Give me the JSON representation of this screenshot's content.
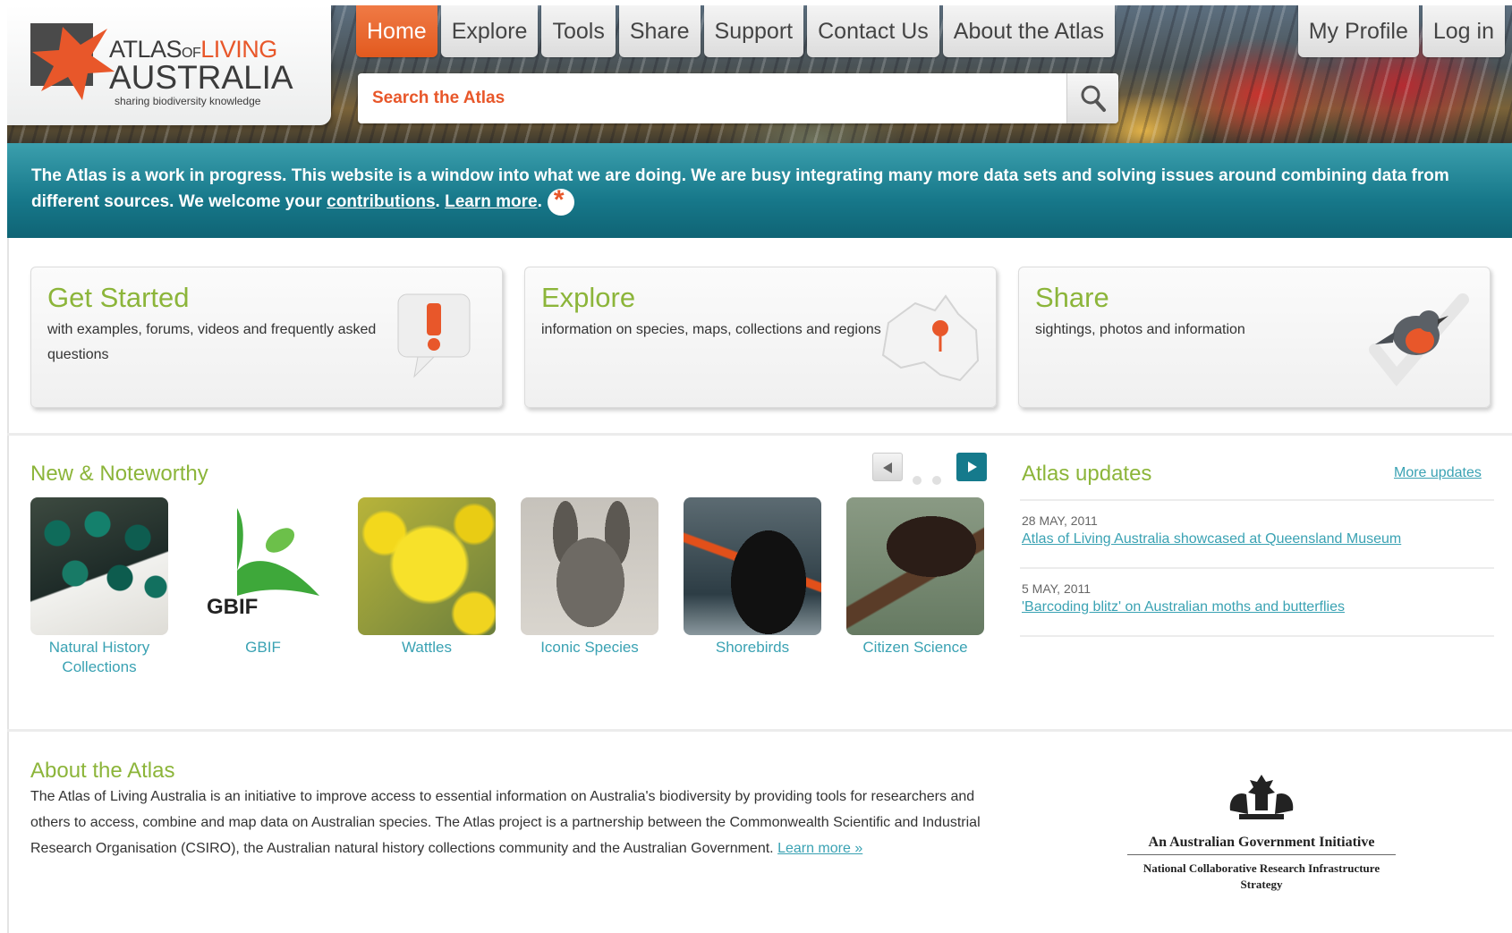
{
  "header": {
    "logo": {
      "line1_a": "ATLAS",
      "line1_b": "OF",
      "line1_c": "LIVING",
      "line2": "AUSTRALIA",
      "tagline": "sharing biodiversity knowledge"
    },
    "nav": [
      {
        "label": "Home",
        "active": true
      },
      {
        "label": "Explore"
      },
      {
        "label": "Tools"
      },
      {
        "label": "Share"
      },
      {
        "label": "Support"
      },
      {
        "label": "Contact Us"
      },
      {
        "label": "About the Atlas"
      }
    ],
    "nav_right": [
      {
        "label": "My Profile"
      },
      {
        "label": "Log in"
      }
    ],
    "search": {
      "placeholder": "Search the Atlas",
      "icon": "search-icon"
    }
  },
  "notice": {
    "text": "The Atlas is a work in progress. This website is a window into what we are doing. We are busy integrating many more data sets and solving issues around combining data from different sources. We welcome your ",
    "link_contrib": "contributions",
    "sep": ". ",
    "link_learn": "Learn more",
    "end": "."
  },
  "cards": [
    {
      "title": "Get Started",
      "desc": "with examples, forums, videos and frequently asked questions",
      "icon": "help-bubble-icon"
    },
    {
      "title": "Explore",
      "desc": "information on species, maps, collections and regions",
      "icon": "australia-map-icon"
    },
    {
      "title": "Share",
      "desc": "sightings, photos and information",
      "icon": "robin-icon"
    }
  ],
  "noteworthy": {
    "title": "New & Noteworthy",
    "items": [
      {
        "label": "Natural History Collections"
      },
      {
        "label": "GBIF"
      },
      {
        "label": "Wattles"
      },
      {
        "label": "Iconic Species"
      },
      {
        "label": "Shorebirds"
      },
      {
        "label": "Citizen Science"
      }
    ],
    "gbif_text": "GBIF"
  },
  "updates": {
    "title": "Atlas updates",
    "more": "More updates",
    "items": [
      {
        "date": "28 MAY, 2011",
        "title": "Atlas of Living Australia showcased at Queensland Museum"
      },
      {
        "date": "5 MAY, 2011",
        "title": "'Barcoding blitz' on Australian moths and butterflies"
      }
    ]
  },
  "about": {
    "title": "About the Atlas",
    "text": "The Atlas of Living Australia is an initiative to improve access to essential information on Australia's biodiversity by providing tools for researchers and others to access, combine and map data on Australian species. The Atlas project is a partnership between the Commonwealth Scientific and Industrial Research Organisation (CSIRO), the Australian natural history collections community and the Australian Government. ",
    "link": "Learn more »"
  },
  "gov": {
    "title": "An Australian Government Initiative",
    "sub": "National Collaborative Research Infrastructure Strategy"
  },
  "colors": {
    "accent_orange": "#e8572a",
    "teal": "#17788a",
    "green_heading": "#8cb53a",
    "link": "#3aa2b3"
  }
}
